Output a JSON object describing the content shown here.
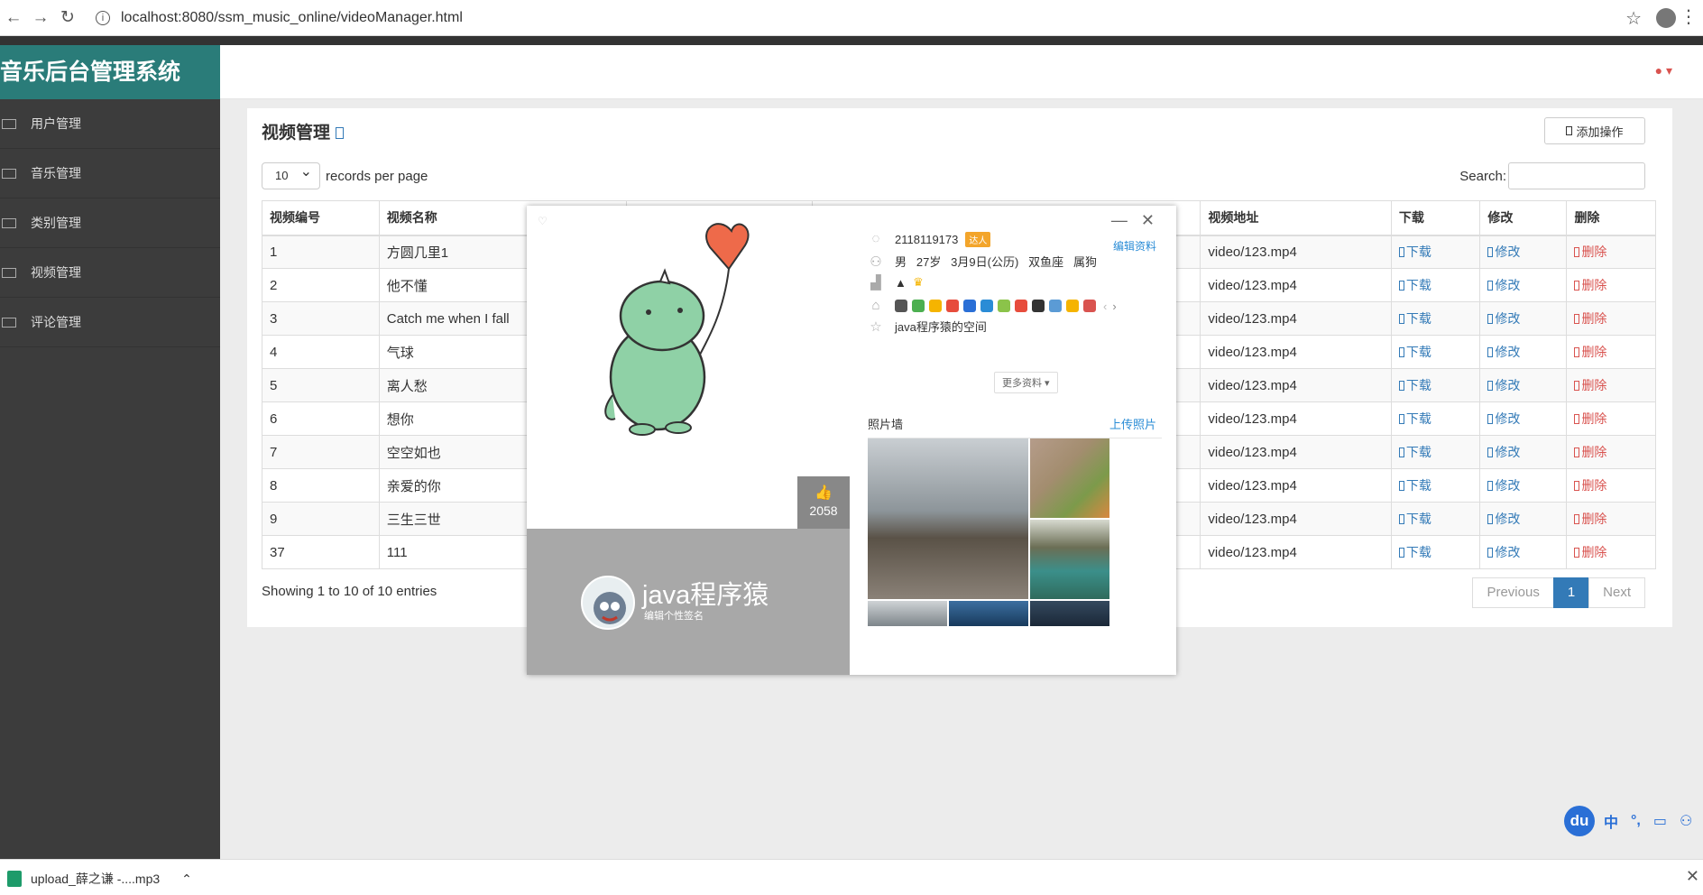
{
  "browser": {
    "url": "localhost:8080/ssm_music_online/videoManager.html"
  },
  "brand": {
    "title": "音乐后台管理系统"
  },
  "sidebar": {
    "items": [
      {
        "label": "用户管理"
      },
      {
        "label": "音乐管理"
      },
      {
        "label": "类别管理"
      },
      {
        "label": "视频管理"
      },
      {
        "label": "评论管理"
      }
    ]
  },
  "panel": {
    "title": "视频管理",
    "add_label": "添加操作",
    "length_value": "10",
    "length_suffix": "records per page",
    "search_label": "Search:",
    "columns": [
      "视频编号",
      "视频名称",
      "",
      "",
      "视频地址",
      "下载",
      "修改",
      "删除"
    ],
    "link_download": "下载",
    "link_edit": "修改",
    "link_delete": "删除",
    "rows": [
      {
        "id": "1",
        "name": "方圆几里1",
        "addr": "video/123.mp4"
      },
      {
        "id": "2",
        "name": "他不懂",
        "addr": "video/123.mp4"
      },
      {
        "id": "3",
        "name": "Catch me when I fall",
        "addr": "video/123.mp4"
      },
      {
        "id": "4",
        "name": "气球",
        "addr": "video/123.mp4"
      },
      {
        "id": "5",
        "name": "离人愁",
        "addr": "video/123.mp4"
      },
      {
        "id": "6",
        "name": "想你",
        "addr": "video/123.mp4"
      },
      {
        "id": "7",
        "name": "空空如也",
        "addr": "video/123.mp4"
      },
      {
        "id": "8",
        "name": "亲爱的你",
        "addr": "video/123.mp4"
      },
      {
        "id": "9",
        "name": "三生三世",
        "addr": "video/123.mp4"
      },
      {
        "id": "37",
        "name": "111",
        "addr": "video/123.mp4"
      }
    ],
    "info": "Showing 1 to 10 of 10 entries",
    "pager": {
      "prev": "Previous",
      "current": "1",
      "next": "Next"
    }
  },
  "popup": {
    "likes": "2058",
    "nickname": "java程序猿",
    "signature": "编辑个性签名",
    "qq": "2118119173",
    "vip_badge": "达人",
    "edit_profile": "编辑资料",
    "gender": "男",
    "age": "27岁",
    "birthday": "3月9日(公历)",
    "zodiac": "双鱼座",
    "shengxiao": "属狗",
    "space": "java程序猿的空间",
    "more": "更多资料",
    "photo_wall": "照片墙",
    "upload_photo": "上传照片",
    "badge_colors": [
      "#555555",
      "#4caf50",
      "#f5b400",
      "#e74c3c",
      "#2a6fd6",
      "#2a8cd6",
      "#8bc34a",
      "#e74c3c",
      "#333333",
      "#5b9bd5",
      "#f5b400",
      "#d9534f"
    ]
  },
  "download_bar": {
    "file": "upload_薛之谦 -....mp3"
  },
  "ime": {
    "logo": "du",
    "lang": "中",
    "punct": "°,"
  }
}
